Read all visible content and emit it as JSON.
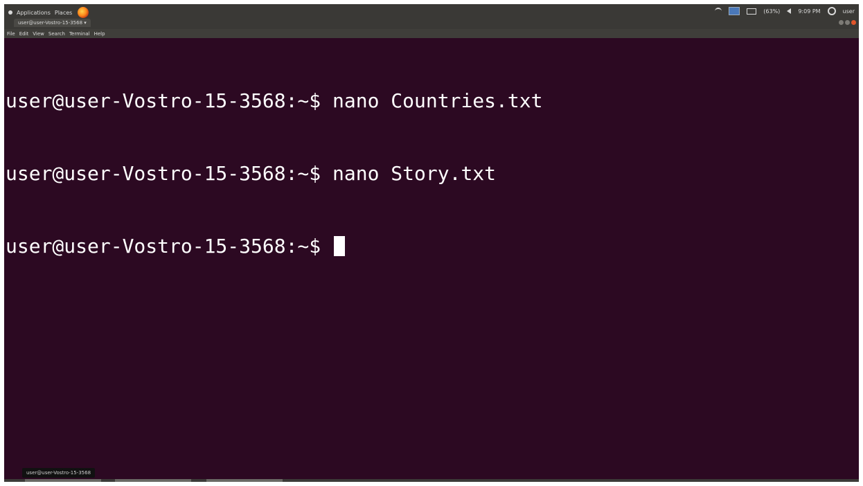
{
  "top_panel": {
    "applications_label": "Applications",
    "places_label": "Places",
    "battery_label": "(63%)",
    "clock": "9:09 PM",
    "user_label": "user"
  },
  "window": {
    "tab_title": "user@user-Vostro-15-3568"
  },
  "menu": {
    "items": [
      "File",
      "Edit",
      "View",
      "Search",
      "Terminal",
      "Help"
    ]
  },
  "terminal": {
    "prompt": "user@user-Vostro-15-3568:~$ ",
    "lines": [
      {
        "command": "nano Countries.txt"
      },
      {
        "command": "nano Story.txt"
      },
      {
        "command": ""
      }
    ]
  },
  "bottom": {
    "tab_label": "user@user-Vostro-15-3568"
  },
  "colors": {
    "terminal_bg": "#2c0922",
    "text": "#ffffff",
    "panel_bg": "#3a3936"
  }
}
